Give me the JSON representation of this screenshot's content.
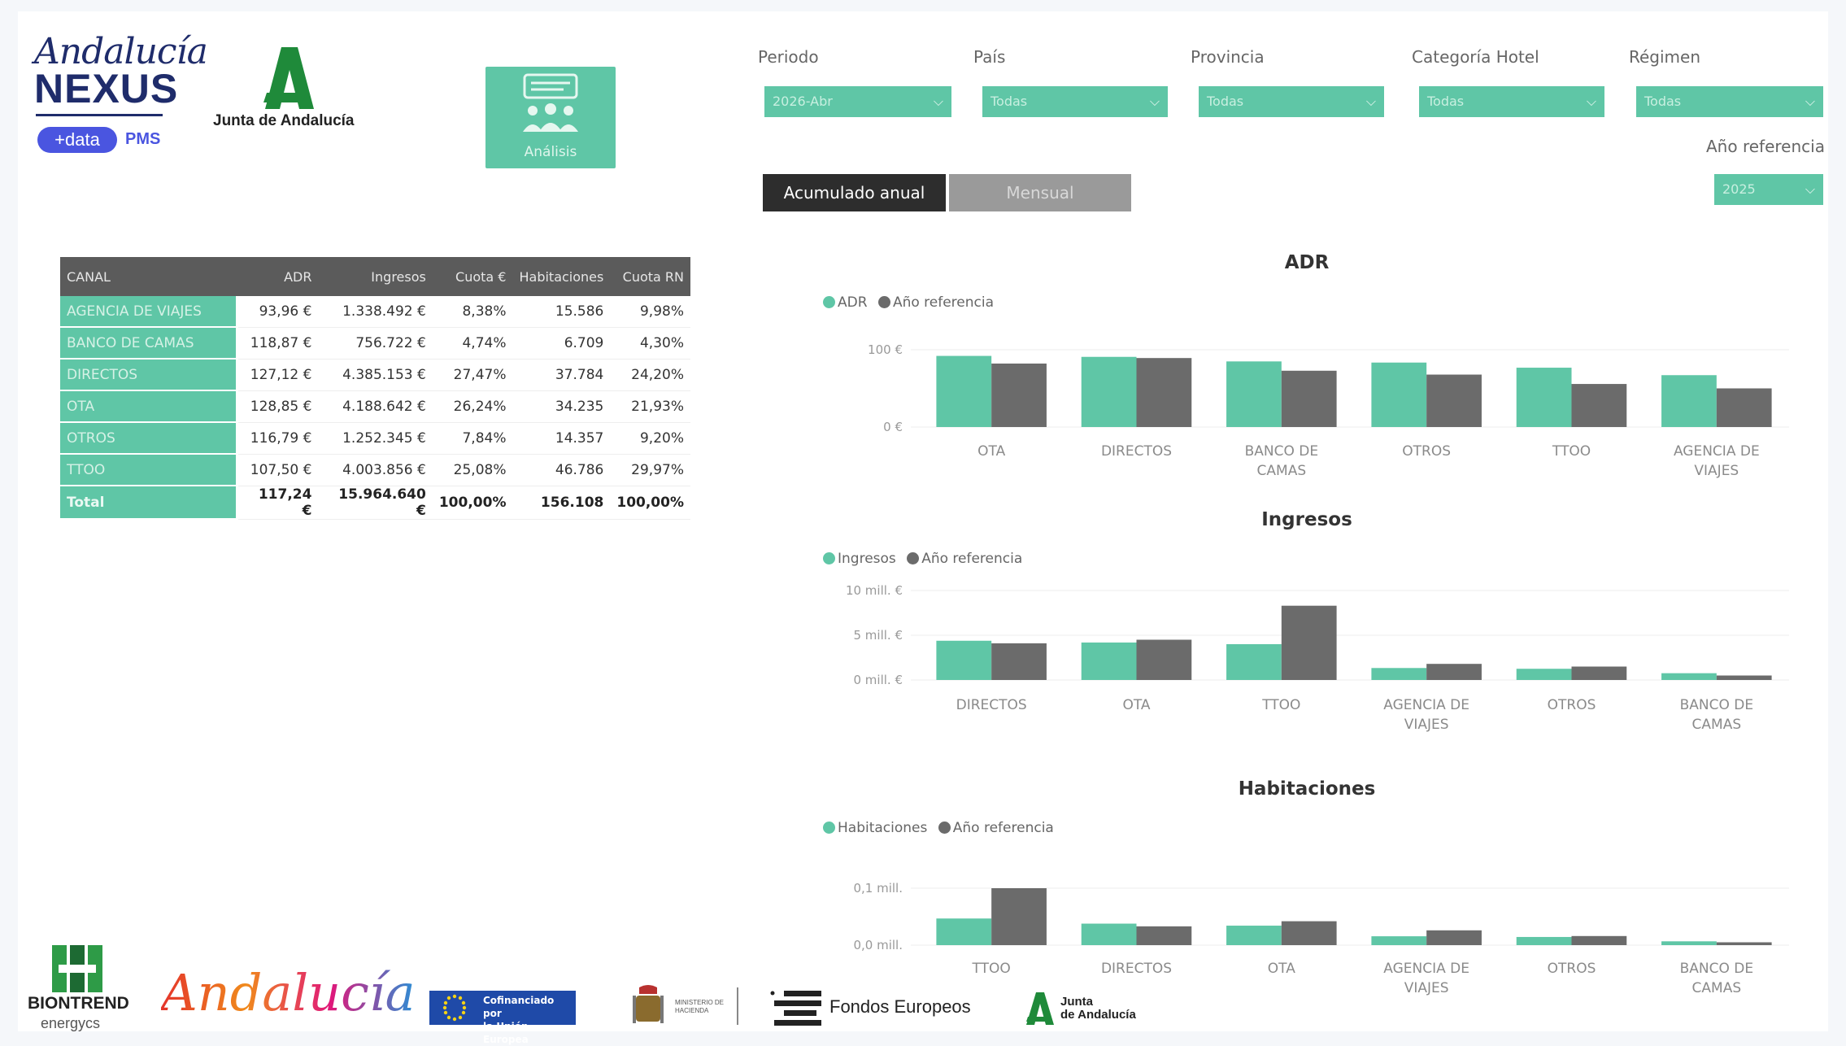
{
  "brand": {
    "nexus_script": "Andalucía",
    "nexus_word": "NEXUS",
    "data_pill": "+data",
    "pms": "PMS",
    "junta_name": "Junta de Andalucía"
  },
  "analisis_button": {
    "label": "Análisis",
    "icon": "people-chat-icon"
  },
  "filters": [
    {
      "label": "Periodo",
      "value": "2026-Abr"
    },
    {
      "label": "País",
      "value": "Todas"
    },
    {
      "label": "Provincia",
      "value": "Todas"
    },
    {
      "label": "Categoría Hotel",
      "value": "Todas"
    },
    {
      "label": "Régimen",
      "value": "Todas"
    }
  ],
  "ref_year": {
    "label": "Año referencia",
    "value": "2025"
  },
  "view_toggle": {
    "acumulado": "Acumulado anual",
    "mensual": "Mensual"
  },
  "table": {
    "headers": [
      "CANAL",
      "ADR",
      "Ingresos",
      "Cuota €",
      "Habitaciones",
      "Cuota RN"
    ],
    "rows": [
      [
        "AGENCIA DE VIAJES",
        "93,96 €",
        "1.338.492 €",
        "8,38%",
        "15.586",
        "9,98%"
      ],
      [
        "BANCO DE CAMAS",
        "118,87 €",
        "756.722 €",
        "4,74%",
        "6.709",
        "4,30%"
      ],
      [
        "DIRECTOS",
        "127,12 €",
        "4.385.153 €",
        "27,47%",
        "37.784",
        "24,20%"
      ],
      [
        "OTA",
        "128,85 €",
        "4.188.642 €",
        "26,24%",
        "34.235",
        "21,93%"
      ],
      [
        "OTROS",
        "116,79 €",
        "1.252.345 €",
        "7,84%",
        "14.357",
        "9,20%"
      ],
      [
        "TTOO",
        "107,50 €",
        "4.003.856 €",
        "25,08%",
        "46.786",
        "29,97%"
      ]
    ],
    "total": [
      "Total",
      "117,24 €",
      "15.964.640 €",
      "100,00%",
      "156.108",
      "100,00%"
    ]
  },
  "colors": {
    "accent": "#5fc6a6",
    "reference": "#6b6b6b",
    "header_dark": "#5b5b5b"
  },
  "chart_data": [
    {
      "type": "bar",
      "title": "ADR",
      "categories": [
        "OTA",
        "DIRECTOS",
        "BANCO DE CAMAS",
        "OTROS",
        "TTOO",
        "AGENCIA DE VIAJES"
      ],
      "series": [
        {
          "name": "ADR",
          "values": [
            128.85,
            127.12,
            118.87,
            116.79,
            107.5,
            93.96
          ]
        },
        {
          "name": "Año referencia",
          "values": [
            115,
            125,
            102,
            95,
            78,
            70
          ]
        }
      ],
      "yticks": [
        "100 €",
        "0 €"
      ],
      "ylim": [
        0,
        140
      ]
    },
    {
      "type": "bar",
      "title": "Ingresos",
      "categories": [
        "DIRECTOS",
        "OTA",
        "TTOO",
        "AGENCIA DE VIAJES",
        "OTROS",
        "BANCO DE CAMAS"
      ],
      "series": [
        {
          "name": "Ingresos",
          "values": [
            4385153,
            4188642,
            4003856,
            1338492,
            1252345,
            756722
          ]
        },
        {
          "name": "Año referencia",
          "values": [
            4100000,
            4500000,
            8300000,
            1800000,
            1500000,
            500000
          ]
        }
      ],
      "yticks": [
        "10 mill. €",
        "5 mill. €",
        "0 mill. €"
      ],
      "ylim": [
        0,
        10000000
      ]
    },
    {
      "type": "bar",
      "title": "Habitaciones",
      "categories": [
        "TTOO",
        "DIRECTOS",
        "OTA",
        "AGENCIA DE VIAJES",
        "OTROS",
        "BANCO DE CAMAS"
      ],
      "series": [
        {
          "name": "Habitaciones",
          "values": [
            46786,
            37784,
            34235,
            15586,
            14357,
            6709
          ]
        },
        {
          "name": "Año referencia",
          "values": [
            100000,
            33000,
            42000,
            26000,
            16000,
            5000
          ]
        }
      ],
      "yticks": [
        "0,1 mill.",
        "0,0 mill."
      ],
      "ylim": [
        0,
        100000
      ]
    }
  ],
  "footer": {
    "biontrend": "BIONTREND",
    "biontrend_sub": "energycs",
    "andalucia": "Andalucía",
    "eu_text_1": "Cofinanciado por",
    "eu_text_2": "la Unión Europea",
    "ministerio": "MINISTERIO DE HACIENDA",
    "fondos": "Fondos Europeos",
    "junta_1": "Junta",
    "junta_2": "de Andalucía"
  }
}
